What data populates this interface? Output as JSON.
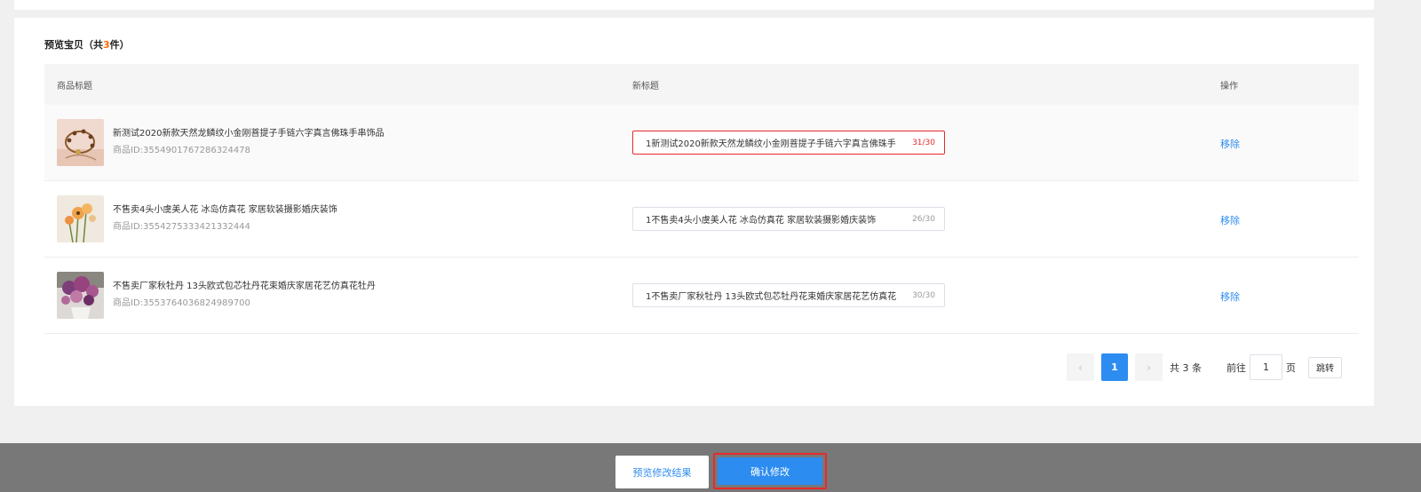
{
  "section": {
    "title_prefix": "预览宝贝（共",
    "count": "3",
    "title_suffix": "件）"
  },
  "table": {
    "headers": [
      "商品标题",
      "新标题",
      "操作"
    ],
    "rows": [
      {
        "title": "新测试2020新款天然龙鳞纹小金刚菩提子手链六字真言佛珠手串饰品",
        "product_id": "商品ID:3554901767286324478",
        "new_title": "1新测试2020新款天然龙鳞纹小金刚菩提子手链六字真言佛珠手",
        "char_count": "31/30",
        "action": "移除"
      },
      {
        "title": "不售卖4头小虞美人花 冰岛仿真花 家居软装摄影婚庆装饰",
        "product_id": "商品ID:3554275333421332444",
        "new_title": "1不售卖4头小虞美人花 冰岛仿真花 家居软装摄影婚庆装饰",
        "char_count": "26/30",
        "action": "移除"
      },
      {
        "title": "不售卖厂家秋牡丹 13头欧式包芯牡丹花束婚庆家居花艺仿真花牡丹",
        "product_id": "商品ID:3553764036824989700",
        "new_title": "1不售卖厂家秋牡丹 13头欧式包芯牡丹花束婚庆家居花艺仿真花",
        "char_count": "30/30",
        "action": "移除"
      }
    ]
  },
  "pagination": {
    "prev_icon": "chevron-left-icon",
    "current_page": "1",
    "next_icon": "chevron-right-icon",
    "total": "共 3 条",
    "goto_label": "前往",
    "goto_value": "1",
    "page_unit": "页",
    "jump_label": "跳转"
  },
  "footer": {
    "preview_label": "预览修改结果",
    "confirm_label": "确认修改"
  },
  "colors": {
    "accent": "#2d8cf0",
    "error": "#e7292b",
    "count_highlight": "#ff6a00"
  }
}
